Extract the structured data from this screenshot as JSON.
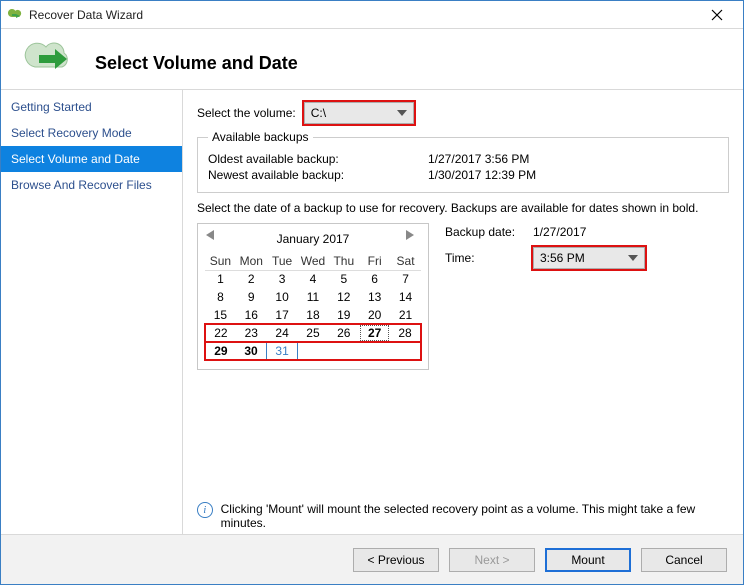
{
  "window": {
    "title": "Recover Data Wizard"
  },
  "header": {
    "title": "Select Volume and Date"
  },
  "nav": {
    "items": [
      {
        "label": "Getting Started",
        "selected": false
      },
      {
        "label": "Select Recovery Mode",
        "selected": false
      },
      {
        "label": "Select Volume and Date",
        "selected": true
      },
      {
        "label": "Browse And Recover Files",
        "selected": false
      }
    ]
  },
  "volume": {
    "label": "Select the volume:",
    "value": "C:\\"
  },
  "backups": {
    "legend": "Available backups",
    "oldest_label": "Oldest available backup:",
    "oldest_value": "1/27/2017 3:56 PM",
    "newest_label": "Newest available backup:",
    "newest_value": "1/30/2017 12:39 PM"
  },
  "desc": "Select the date of a backup to use for recovery. Backups are available for dates shown in bold.",
  "calendar": {
    "month_label": "January 2017",
    "dow": [
      "Sun",
      "Mon",
      "Tue",
      "Wed",
      "Thu",
      "Fri",
      "Sat"
    ],
    "weeks": [
      [
        {
          "n": 1
        },
        {
          "n": 2
        },
        {
          "n": 3
        },
        {
          "n": 4
        },
        {
          "n": 5
        },
        {
          "n": 6
        },
        {
          "n": 7
        }
      ],
      [
        {
          "n": 8
        },
        {
          "n": 9
        },
        {
          "n": 10
        },
        {
          "n": 11
        },
        {
          "n": 12
        },
        {
          "n": 13
        },
        {
          "n": 14
        }
      ],
      [
        {
          "n": 15
        },
        {
          "n": 16
        },
        {
          "n": 17
        },
        {
          "n": 18
        },
        {
          "n": 19
        },
        {
          "n": 20
        },
        {
          "n": 21
        }
      ],
      [
        {
          "n": 22
        },
        {
          "n": 23
        },
        {
          "n": 24
        },
        {
          "n": 25
        },
        {
          "n": 26
        },
        {
          "n": 27,
          "sel": true,
          "bold": true
        },
        {
          "n": 28
        }
      ],
      [
        {
          "n": 29,
          "bold": true
        },
        {
          "n": 30,
          "bold": true
        },
        {
          "n": 31,
          "today": true
        },
        {
          "n": "",
          "dim": true
        },
        {
          "n": "",
          "dim": true
        },
        {
          "n": "",
          "dim": true
        },
        {
          "n": "",
          "dim": true
        }
      ]
    ],
    "highlight_rows": [
      3,
      4
    ]
  },
  "backup_date": {
    "label": "Backup date:",
    "value": "1/27/2017"
  },
  "time": {
    "label": "Time:",
    "value": "3:56 PM"
  },
  "info": "Clicking 'Mount' will mount the selected recovery point as a volume. This might take a few minutes.",
  "footer": {
    "previous": "< Previous",
    "next": "Next >",
    "mount": "Mount",
    "cancel": "Cancel"
  }
}
